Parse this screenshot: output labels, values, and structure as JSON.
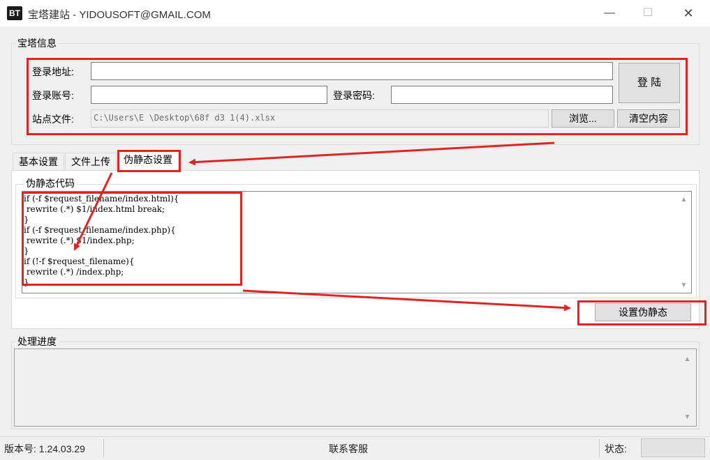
{
  "window": {
    "icon_text": "BT",
    "title": "宝塔建站 - YIDOUSOFT@GMAIL.COM",
    "minimize": "—",
    "maximize": "☐",
    "close": "✕"
  },
  "bt_info": {
    "group_title": "宝塔信息",
    "login_url_label": "登录地址:",
    "login_url_value": "",
    "account_label": "登录账号:",
    "account_value": "",
    "password_label": "登录密码:",
    "password_value": "",
    "login_button": "登 陆",
    "site_file_label": "站点文件:",
    "site_file_value": "C:\\Users\\E    \\Desktop\\68f                               d3 1(4).xlsx",
    "browse_button": "浏览...",
    "clear_button": "清空内容"
  },
  "tabs": [
    {
      "label": "基本设置",
      "active": false
    },
    {
      "label": "文件上传",
      "active": false
    },
    {
      "label": "伪静态设置",
      "active": true
    }
  ],
  "rewrite": {
    "group_title": "伪静态代码",
    "code": "if (-f $request_filename/index.html){\n rewrite (.*) $1/index.html break;\n}\nif (-f $request_filename/index.php){\n rewrite (.*) $1/index.php;\n}\nif (!-f $request_filename){\n rewrite (.*) /index.php;\n}",
    "set_button": "设置伪静态"
  },
  "progress": {
    "group_title": "处理进度",
    "log": ""
  },
  "statusbar": {
    "version": "版本号: 1.24.03.29",
    "contact": "联系客服",
    "status_label": "状态:",
    "status_value": ""
  },
  "colors": {
    "highlight": "#e02424",
    "window_bg": "#f0f0f0"
  }
}
